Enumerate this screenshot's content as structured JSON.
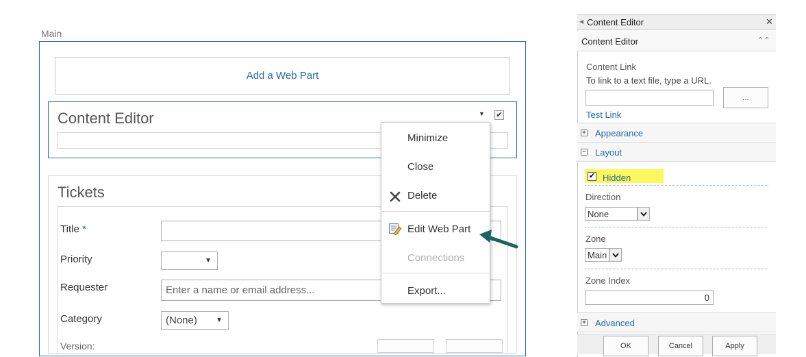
{
  "main_zone": {
    "title": "Main",
    "add_web_part": "Add a Web Part",
    "content_editor_title": "Content Editor",
    "tickets": {
      "title": "Tickets",
      "fields": {
        "title_label": "Title",
        "required_marker": "*",
        "priority_label": "Priority",
        "requester_label": "Requester",
        "requester_placeholder": "Enter a name or email address...",
        "category_label": "Category",
        "category_value": "(None)",
        "version_label": "Version:"
      }
    }
  },
  "context_menu": {
    "items": [
      "Minimize",
      "Close",
      "Delete",
      "Edit Web Part",
      "Connections",
      "Export..."
    ]
  },
  "tool_pane": {
    "header": "Content Editor",
    "subheader": "Content Editor",
    "content_link_label": "Content Link",
    "content_link_help": "To link to a text file, type a URL.",
    "browse_button": "...",
    "test_link": "Test Link",
    "sections": {
      "appearance": "Appearance",
      "layout": "Layout",
      "advanced": "Advanced"
    },
    "layout": {
      "hidden_label": "Hidden",
      "hidden_checked": true,
      "direction_label": "Direction",
      "direction_value": "None",
      "zone_label": "Zone",
      "zone_value": "Main",
      "zone_index_label": "Zone Index",
      "zone_index_value": "0"
    },
    "buttons": {
      "ok": "OK",
      "cancel": "Cancel",
      "apply": "Apply"
    }
  },
  "colors": {
    "accent_blue": "#1e6ba8",
    "highlight_yellow": "#fcf85b",
    "arrow_teal": "#1a6363"
  }
}
